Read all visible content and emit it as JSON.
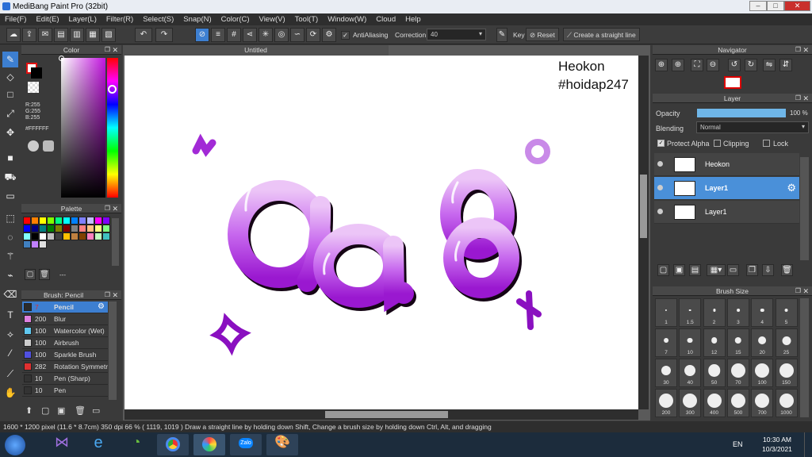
{
  "window": {
    "title": "MediBang Paint Pro (32bit)",
    "min": "–",
    "max": "□",
    "close": "✕"
  },
  "menu": [
    "File(F)",
    "Edit(E)",
    "Layer(L)",
    "Filter(R)",
    "Select(S)",
    "Snap(N)",
    "Color(C)",
    "View(V)",
    "Tool(T)",
    "Window(W)",
    "Cloud",
    "Help"
  ],
  "toolbar": {
    "antialiasing": "AntiAliasing",
    "correction_label": "Correction",
    "correction_value": "40",
    "key_label": "Key",
    "reset": "Reset",
    "create_line": "Create a straight line"
  },
  "color_panel": {
    "title": "Color",
    "r": "R:255",
    "g": "G:255",
    "b": "B:255",
    "hex": "#FFFFFF"
  },
  "palette_panel": {
    "title": "Palette",
    "dashes": "---"
  },
  "brush_panel": {
    "title": "Brush: Pencil",
    "brushes": [
      {
        "size": "7",
        "name": "Pencil",
        "color": "#2b2b2b"
      },
      {
        "size": "200",
        "name": "Blur",
        "color": "#e080e0"
      },
      {
        "size": "100",
        "name": "Watercolor (Wet)",
        "color": "#60c8f0"
      },
      {
        "size": "100",
        "name": "Airbrush",
        "color": "#cccccc"
      },
      {
        "size": "100",
        "name": "Sparkle Brush",
        "color": "#5050e0"
      },
      {
        "size": "282",
        "name": "Rotation Symmetry",
        "color": "#e03030"
      },
      {
        "size": "10",
        "name": "Pen (Sharp)",
        "color": "#333333"
      },
      {
        "size": "10",
        "name": "Pen",
        "color": "#333333"
      }
    ]
  },
  "document": {
    "tab": "Untitled"
  },
  "canvas_text": {
    "line1": "Heokon",
    "line2": "#hoidap247",
    "art": "9a8"
  },
  "navigator": {
    "title": "Navigator"
  },
  "layer_panel": {
    "title": "Layer",
    "opacity_label": "Opacity",
    "opacity_value": "100 %",
    "opacity": 1.0,
    "blending_label": "Blending",
    "blending_value": "Normal",
    "protect_alpha": "Protect Alpha",
    "clipping": "Clipping",
    "lock": "Lock",
    "layers": [
      {
        "name": "Heokon",
        "selected": false
      },
      {
        "name": "Layer1",
        "selected": true
      },
      {
        "name": "Layer1",
        "selected": false
      }
    ]
  },
  "brush_size": {
    "title": "Brush Size",
    "sizes": [
      "1",
      "1.5",
      "2",
      "3",
      "4",
      "5",
      "7",
      "10",
      "12",
      "15",
      "20",
      "25",
      "30",
      "40",
      "50",
      "70",
      "100",
      "150",
      "200",
      "300",
      "400",
      "500",
      "700",
      "1000"
    ]
  },
  "status": {
    "text": "1600 * 1200 pixel   (11.6 * 8.7cm)  350 dpi   66 %    ( 1119, 1019 )   Draw a straight line by holding down Shift, Change a brush size by holding down Ctrl, Alt, and dragging"
  },
  "taskbar": {
    "lang": "EN",
    "time": "10:30 AM",
    "date": "10/3/2021",
    "zalo": "Zalo"
  },
  "colors": {
    "accent": "#3d7fd1",
    "art_purple": "#b24ee0",
    "art_light": "#e6b7f5"
  }
}
